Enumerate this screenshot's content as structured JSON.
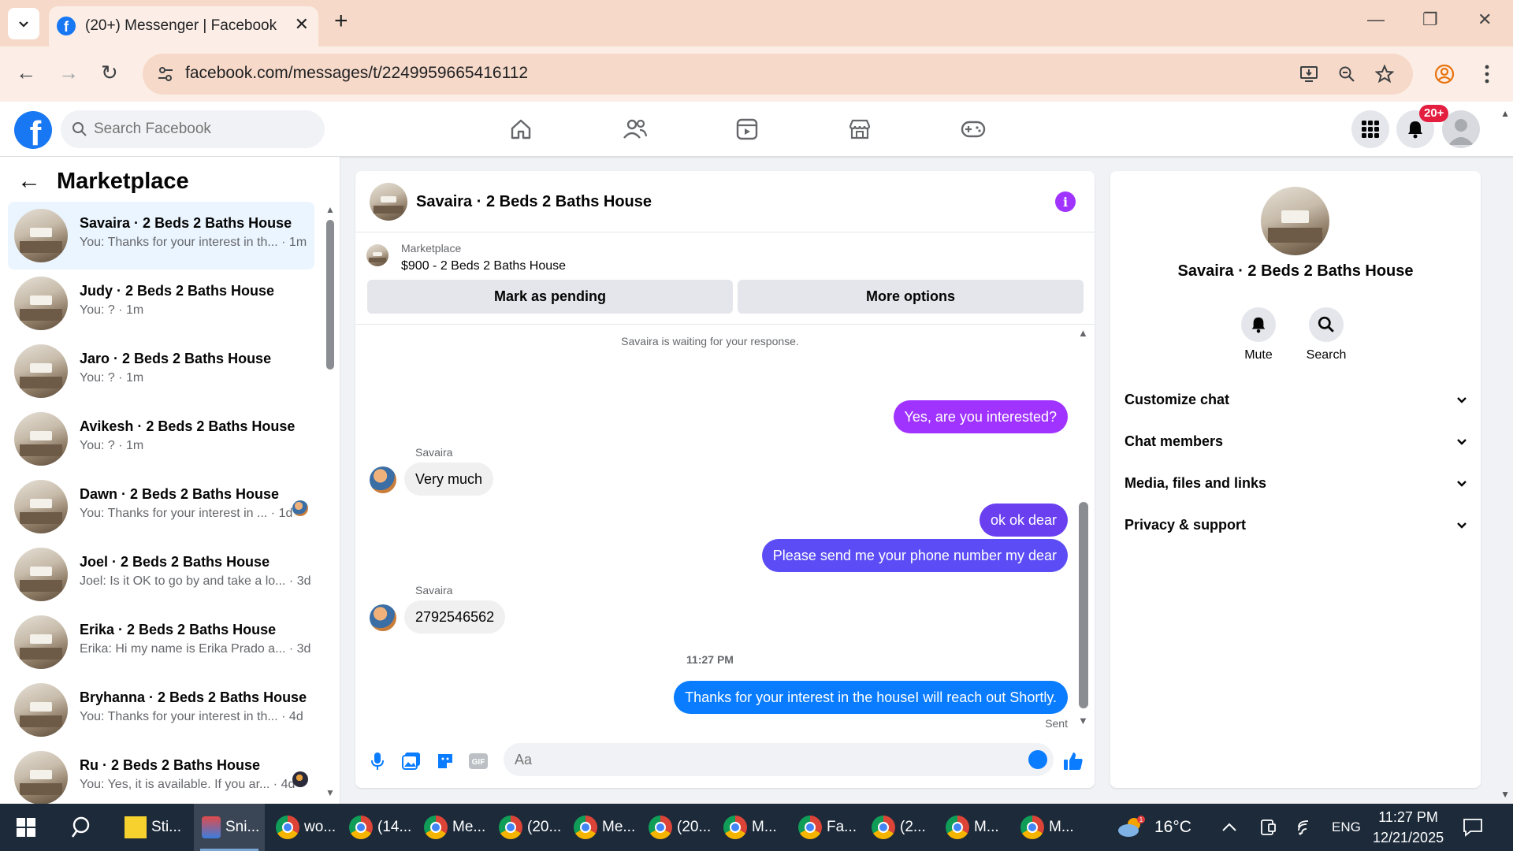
{
  "browser": {
    "tab_title": "(20+) Messenger | Facebook",
    "url": "facebook.com/messages/t/2249959665416112"
  },
  "header": {
    "search_placeholder": "Search Facebook",
    "notification_badge": "20+"
  },
  "sidebar": {
    "title": "Marketplace",
    "conversations": [
      {
        "name": "Savaira · 2 Beds 2 Baths House",
        "preview": "You: Thanks for your interest in th... · 1m",
        "active": true
      },
      {
        "name": "Judy · 2 Beds 2 Baths House",
        "preview": "You: ? · 1m"
      },
      {
        "name": "Jaro · 2 Beds 2 Baths House",
        "preview": "You: ? · 1m"
      },
      {
        "name": "Avikesh · 2 Beds 2 Baths House",
        "preview": "You: ? · 1m"
      },
      {
        "name": "Dawn · 2 Beds 2 Baths House",
        "preview": "You: Thanks for your interest in ... · 1d"
      },
      {
        "name": "Joel · 2 Beds 2 Baths House",
        "preview": "Joel: Is it OK to go by and take a lo... · 3d"
      },
      {
        "name": "Erika · 2 Beds 2 Baths House",
        "preview": "Erika: Hi my name is Erika Prado a... · 3d"
      },
      {
        "name": "Bryhanna · 2 Beds 2 Baths House",
        "preview": "You: Thanks for your interest in th... · 4d"
      },
      {
        "name": "Ru · 2 Beds 2 Baths House",
        "preview": "You: Yes, it is available. If you ar... · 4d"
      }
    ]
  },
  "chat": {
    "title": "Savaira · 2 Beds 2 Baths House",
    "marketplace_label": "Marketplace",
    "listing": "$900 - 2 Beds 2 Baths House",
    "mark_pending": "Mark as pending",
    "more_options": "More options",
    "waiting_notice": "Savaira is waiting for your response.",
    "messages": [
      {
        "from": "me",
        "text": "Yes, are you interested?"
      },
      {
        "from": "Savaira",
        "text": "Very much"
      },
      {
        "from": "me",
        "text": "ok ok dear"
      },
      {
        "from": "me",
        "text": "Please send me your phone number my dear"
      },
      {
        "from": "Savaira",
        "text": "2792546562"
      },
      {
        "from": "me",
        "text": "Thanks for your interest in the houseI will reach out Shortly."
      }
    ],
    "sender_name": "Savaira",
    "timestamp": "11:27 PM",
    "status": "Sent",
    "composer_placeholder": "Aa",
    "colors": {
      "purple": "#a033ff",
      "blue": "#0a7cff",
      "violet": "#5b4cf5"
    }
  },
  "info_panel": {
    "name": "Savaira · 2 Beds 2 Baths House",
    "actions": [
      "Mute",
      "Search"
    ],
    "sections": [
      "Customize chat",
      "Chat members",
      "Media, files and links",
      "Privacy & support"
    ]
  },
  "taskbar": {
    "items": [
      "Sti...",
      "Sni...",
      "wo...",
      "(14...",
      "Me...",
      "(20...",
      "Me...",
      "(20...",
      "M...",
      "Fa...",
      "(2...",
      "M...",
      "M..."
    ],
    "weather": "16°C",
    "language": "ENG",
    "time": "11:27 PM",
    "date": "12/21/2025"
  }
}
